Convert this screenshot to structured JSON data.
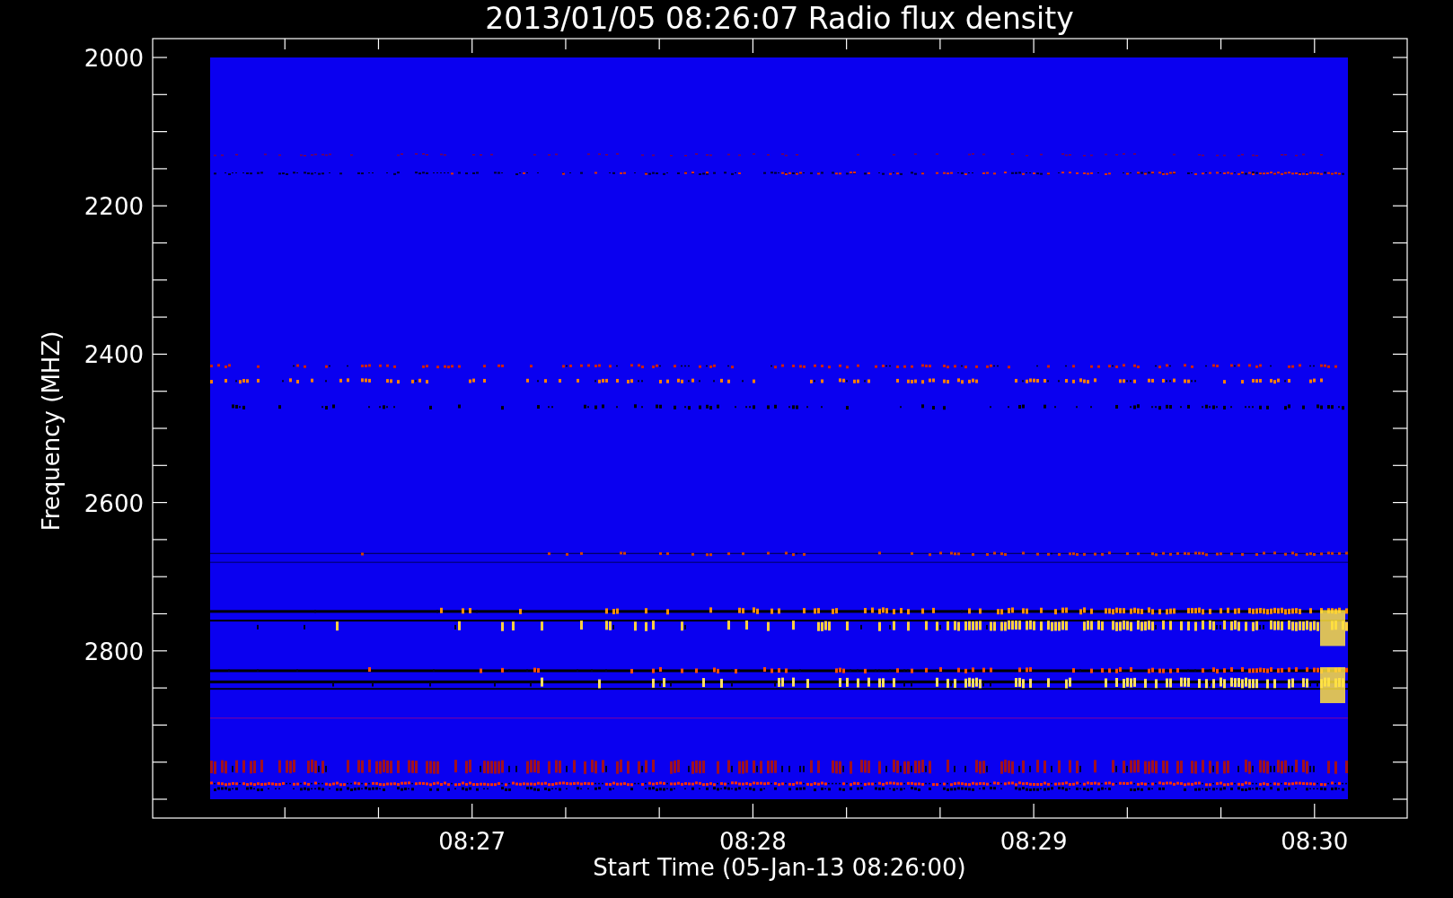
{
  "title": "2013/01/05 08:26:07 Radio flux density",
  "y_axis": {
    "label": "Frequency (MHZ)",
    "ticks": [
      "2000",
      "2200",
      "2400",
      "2600",
      "2800"
    ]
  },
  "x_axis": {
    "label": "Start Time (05-Jan-13 08:26:00)",
    "ticks": [
      "08:27",
      "08:28",
      "08:29",
      "08:30"
    ]
  }
}
